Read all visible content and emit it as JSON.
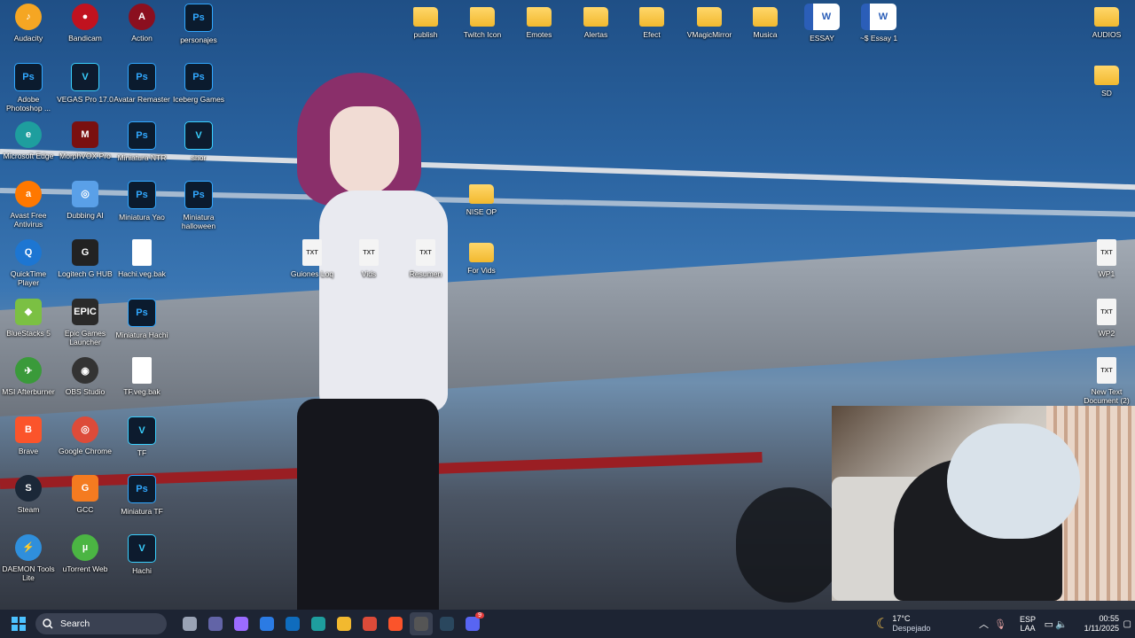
{
  "desktop": {
    "left_icons": [
      {
        "label": "Audacity",
        "icon": "audacity-icon"
      },
      {
        "label": "Bandicam",
        "icon": "bandicam-icon"
      },
      {
        "label": "Action",
        "icon": "action-icon"
      },
      {
        "label": "personajes",
        "icon": "photoshop-file-icon"
      },
      {
        "label": "Adobe Photoshop ...",
        "icon": "photoshop-icon"
      },
      {
        "label": "VEGAS Pro 17.0",
        "icon": "vegas-icon"
      },
      {
        "label": "Avatar Remaster",
        "icon": "photoshop-file-icon"
      },
      {
        "label": "Iceberg Games",
        "icon": "photoshop-file-icon"
      },
      {
        "label": "Microsoft Edge",
        "icon": "edge-icon"
      },
      {
        "label": "MorphVOX Pro",
        "icon": "morphvox-icon"
      },
      {
        "label": "Miniatura NTR",
        "icon": "photoshop-file-icon"
      },
      {
        "label": "shor",
        "icon": "vegas-file-icon"
      },
      {
        "label": "Avast Free Antivirus",
        "icon": "avast-icon"
      },
      {
        "label": "Dubbing AI",
        "icon": "dubbing-ai-icon"
      },
      {
        "label": "Miniatura Yao",
        "icon": "photoshop-file-icon"
      },
      {
        "label": "Miniatura halloween",
        "icon": "photoshop-file-icon"
      },
      {
        "label": "QuickTime Player",
        "icon": "quicktime-icon"
      },
      {
        "label": "Logitech G HUB",
        "icon": "logitech-icon"
      },
      {
        "label": "Hachi.veg.bak",
        "icon": "file-icon"
      },
      {
        "label": "BlueStacks 5",
        "icon": "bluestacks-icon"
      },
      {
        "label": "Epic Games Launcher",
        "icon": "epic-games-icon"
      },
      {
        "label": "Miniatura Hachi",
        "icon": "photoshop-file-icon"
      },
      {
        "label": "MSI Afterburner",
        "icon": "msi-afterburner-icon"
      },
      {
        "label": "OBS Studio",
        "icon": "obs-icon"
      },
      {
        "label": "TF.veg.bak",
        "icon": "file-icon"
      },
      {
        "label": "Brave",
        "icon": "brave-icon"
      },
      {
        "label": "Google Chrome",
        "icon": "chrome-icon"
      },
      {
        "label": "TF",
        "icon": "vegas-file-icon"
      },
      {
        "label": "Steam",
        "icon": "steam-icon"
      },
      {
        "label": "GCC",
        "icon": "gcc-icon"
      },
      {
        "label": "Miniatura TF",
        "icon": "photoshop-file-icon"
      },
      {
        "label": "DAEMON Tools Lite",
        "icon": "daemon-tools-icon"
      },
      {
        "label": "uTorrent Web",
        "icon": "utorrent-icon"
      },
      {
        "label": "Hachi",
        "icon": "vegas-file-icon"
      }
    ],
    "top_icons": [
      {
        "label": "publish",
        "icon": "folder-icon"
      },
      {
        "label": "Twitch Icon",
        "icon": "folder-icon"
      },
      {
        "label": "Emotes",
        "icon": "folder-icon"
      },
      {
        "label": "Alertas",
        "icon": "folder-icon"
      },
      {
        "label": "Efect",
        "icon": "folder-icon"
      },
      {
        "label": "VMagicMirror",
        "icon": "folder-icon"
      },
      {
        "label": "Musica",
        "icon": "folder-icon"
      },
      {
        "label": "ESSAY",
        "icon": "word-icon"
      },
      {
        "label": "~$ Essay 1",
        "icon": "word-icon"
      },
      {
        "label": "AUDIOS",
        "icon": "folder-icon"
      }
    ],
    "middle_icons": [
      {
        "label": "NISE OP",
        "icon": "folder-icon"
      },
      {
        "label": "Guiones Loq",
        "icon": "txt-file-icon"
      },
      {
        "label": "Vids",
        "icon": "txt-file-icon"
      },
      {
        "label": "Resumen",
        "icon": "txt-file-icon"
      },
      {
        "label": "For Vids",
        "icon": "folder-icon"
      }
    ],
    "right_icons": [
      {
        "label": "SD",
        "icon": "folder-icon"
      },
      {
        "label": "WP1",
        "icon": "txt-file-icon"
      },
      {
        "label": "WP2",
        "icon": "txt-file-icon"
      },
      {
        "label": "New Text Document (2)",
        "icon": "txt-file-icon"
      }
    ]
  },
  "taskbar": {
    "search_label": "Search",
    "apps": [
      "task-view-icon",
      "teams-icon",
      "copilot-icon",
      "store-icon",
      "outlook-icon",
      "edge-icon",
      "file-explorer-icon",
      "chrome-icon",
      "brave-icon",
      "obs-icon",
      "steam-icon",
      "discord-icon"
    ],
    "weather_temp": "17°C",
    "weather_desc": "Despejado",
    "lang_line1": "ESP",
    "lang_line2": "LAA",
    "time": "00:55",
    "date": "1/11/2025",
    "discord_badge": "9"
  },
  "colors": {
    "taskbar_bg": "#1d2433",
    "accent": "#31a8ff"
  }
}
